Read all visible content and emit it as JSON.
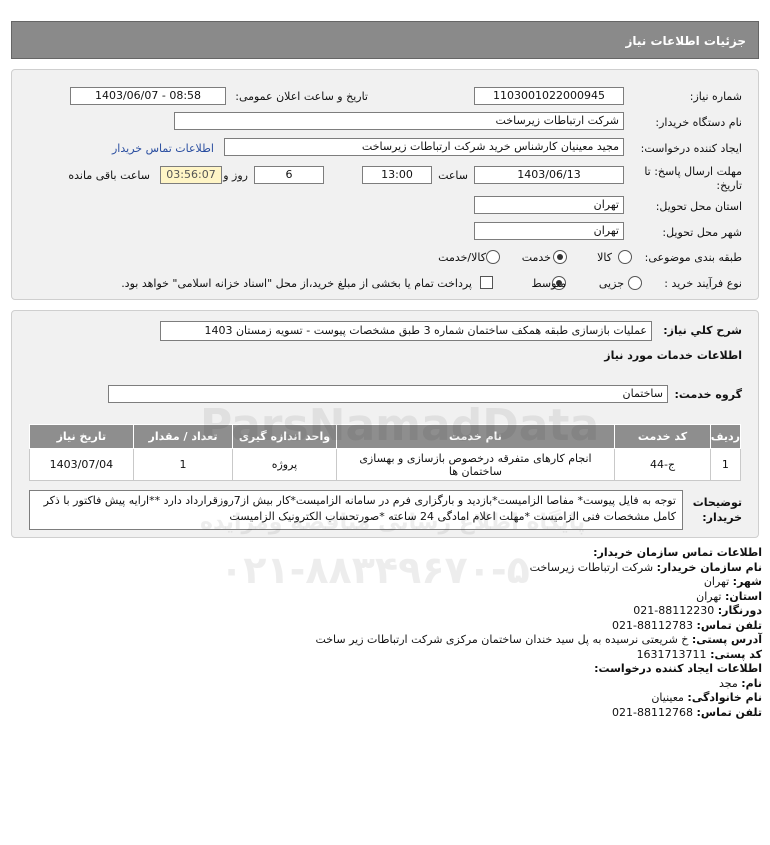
{
  "header": {
    "title": "جزئیات اطلاعات نیاز"
  },
  "form": {
    "need_number": {
      "label": "شماره نیاز:",
      "value": "1103001022000945"
    },
    "announce": {
      "label": "تاریخ و ساعت اعلان عمومی:",
      "value": "1403/06/07 - 08:58"
    },
    "buyer_org": {
      "label": "نام دستگاه خریدار:",
      "value": "شرکت ارتباطات زیرساخت"
    },
    "requester": {
      "label": "ایجاد کننده درخواست:",
      "value": "مجید معینیان کارشناس خرید شرکت ارتباطات زیرساخت",
      "contact_link": "اطلاعات تماس خریدار"
    },
    "deadline": {
      "label_line1": "مهلت ارسال پاسخ: تا",
      "label_line2": "تاریخ:",
      "date": "1403/06/13",
      "time_label": "ساعت",
      "time": "13:00",
      "days": "6",
      "days_label": "روز و",
      "remaining": "03:56:07",
      "remaining_label": "ساعت باقی مانده"
    },
    "delivery_province": {
      "label": "استان محل تحویل:",
      "value": "تهران"
    },
    "delivery_city": {
      "label": "شهر محل تحویل:",
      "value": "تهران"
    },
    "category": {
      "label": "طبقه بندی موضوعی:",
      "options": [
        "کالا",
        "خدمت",
        "کالا/خدمت"
      ],
      "selected": "خدمت"
    },
    "process": {
      "label": "نوع فرآیند خرید :",
      "options": [
        "جزیی",
        "متوسط"
      ],
      "selected": "متوسط",
      "payment_note": "پرداخت تمام یا بخشی از مبلغ خرید،از محل \"اسناد خزانه اسلامی\" خواهد بود."
    }
  },
  "summary": {
    "label": "شرح کلي نياز:",
    "value": "عملیات بازسازی طبقه همکف ساختمان شماره 3 طبق مشخصات پیوست - تسویه زمستان 1403"
  },
  "services": {
    "title": "اطلاعات خدمات مورد نیاز",
    "group_label": "گروه خدمت:",
    "group_value": "ساختمان",
    "columns": [
      "ردیف",
      "کد خدمت",
      "نام خدمت",
      "واحد اندازه گیری",
      "تعداد / مقدار",
      "تاریخ نیاز"
    ],
    "rows": [
      {
        "row": "1",
        "code": "ج-44",
        "name": "انجام کارهای متفرقه درخصوص بازسازی و بهسازی ساختمان ها",
        "unit": "پروژه",
        "qty": "1",
        "date": "1403/07/04"
      }
    ]
  },
  "buyer_notes": {
    "label_line1": "توضیحات",
    "label_line2": "خریدار:",
    "text": "توجه به فایل پیوست* مفاصا الزامیست*بازدید و بارگزاری فرم در سامانه الزامیست*کار بیش از7روزقرارداد دارد **ارایه پیش فاکتور با ذکر کامل مشخصات فنی الزامیست *مهلت اعلام امادگی 24 ساعته *صورتحساب الکترونیک الزامیست"
  },
  "contact": {
    "org_title": "اطلاعات تماس سازمان خریدار:",
    "org_name_label": "نام سازمان خریدار:",
    "org_name": "شرکت ارتباطات زیرساخت",
    "city_label": "شهر:",
    "city": "تهران",
    "province_label": "استان:",
    "province": "تهران",
    "fax_label": "دورنگار:",
    "fax": "88112230-021",
    "phone_label": "تلفن تماس:",
    "phone": "88112783-021",
    "address_label": "آدرس پستی:",
    "address": "خ شریعتی نرسیده به پل سید خندان ساختمان مرکزی شرکت ارتباطات زیر ساخت",
    "postal_label": "کد پستی:",
    "postal": "1631713711",
    "creator_title": "اطلاعات ایجاد کننده درخواست:",
    "first_name_label": "نام:",
    "first_name": "مجد",
    "last_name_label": "نام خانوادگی:",
    "last_name": "معینیان",
    "creator_phone_label": "تلفن تماس:",
    "creator_phone": "88112768-021"
  },
  "watermark": {
    "brand": "ParsNamadData",
    "tagline": "پایگاه اطلاع رسانی مناقصه ومزایده",
    "phone": "۰۲۱-۸۸۳۴۹۶۷۰-۵"
  }
}
